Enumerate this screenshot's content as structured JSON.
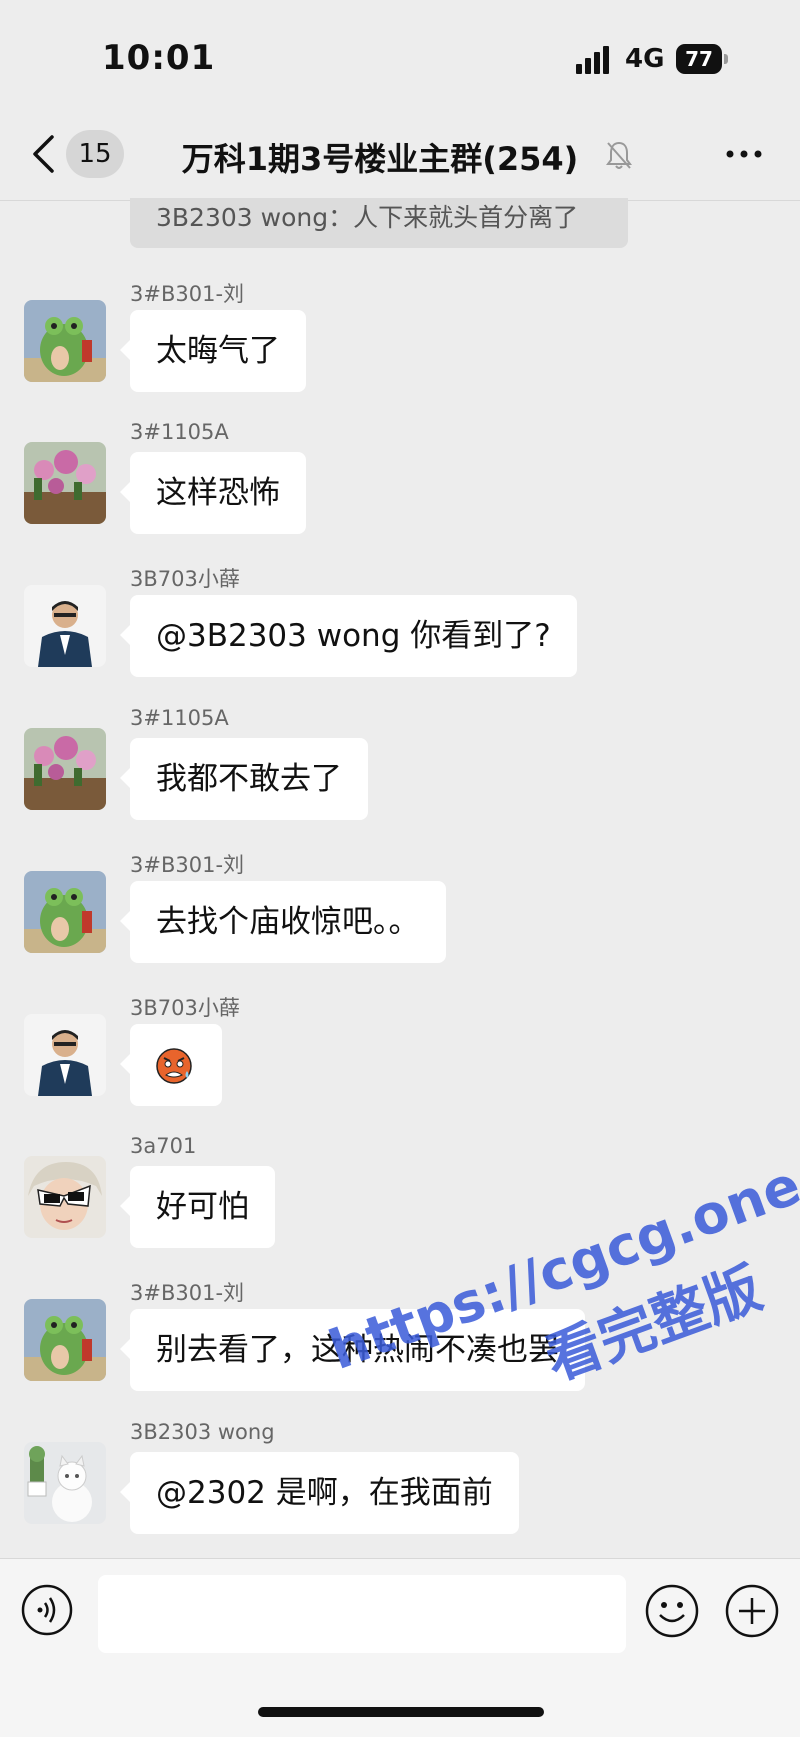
{
  "status": {
    "time": "10:01",
    "network": "4G",
    "battery": "77"
  },
  "nav": {
    "unread_count": "15",
    "title": "万科1期3号楼业主群(254)",
    "icons": {
      "back": "chevron-left-icon",
      "mute": "bell-muted-icon",
      "more": "more-dots-icon"
    }
  },
  "system_message": "3B2303 wong：人下来就头首分离了",
  "messages": [
    {
      "sender": "3#B301-刘",
      "text": "太晦气了",
      "avatar": "frog-avatar"
    },
    {
      "sender": "3#1105A",
      "text": "这样恐怖",
      "avatar": "flowers-avatar"
    },
    {
      "sender": "3B703小薛",
      "text": "@3B2303 wong 你看到了?",
      "avatar": "man-suit-avatar"
    },
    {
      "sender": "3#1105A",
      "text": "我都不敢去了",
      "avatar": "flowers-avatar"
    },
    {
      "sender": "3#B301-刘",
      "text": "去找个庙收惊吧。。",
      "avatar": "frog-avatar"
    },
    {
      "sender": "3B703小薛",
      "text": "",
      "sticker": "scared-face-emoji",
      "avatar": "man-suit-avatar"
    },
    {
      "sender": "3a701",
      "text": "好可怕",
      "avatar": "girl-sunglasses-avatar"
    },
    {
      "sender": "3#B301-刘",
      "text": "别去看了，这种热闹不凑也罢",
      "avatar": "frog-avatar"
    },
    {
      "sender": "3B2303 wong",
      "text": "@2302 是啊，在我面前",
      "avatar": "cat-avatar"
    }
  ],
  "watermark": {
    "line1": "https://cgcg.one",
    "line2": "看完整版"
  },
  "input_bar": {
    "icons": {
      "voice": "voice-icon",
      "emoji": "emoji-icon",
      "plus": "plus-icon"
    }
  },
  "colors": {
    "background": "#ededed",
    "bubble": "#ffffff",
    "watermark": "#3a5bd9"
  }
}
